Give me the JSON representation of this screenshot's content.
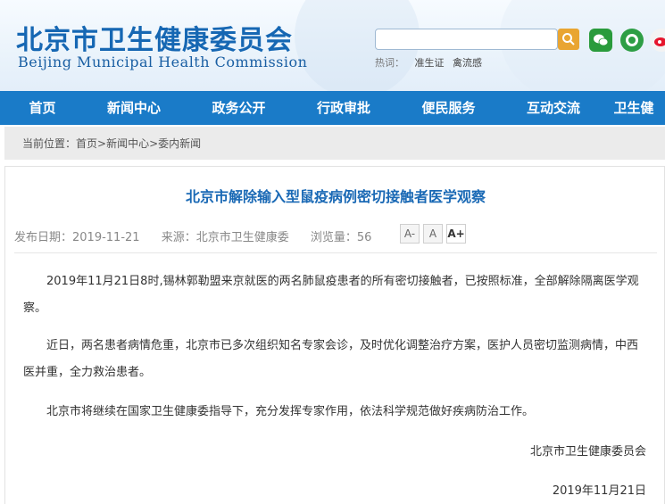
{
  "header": {
    "title_cn": "北京市卫生健康委员会",
    "title_en": "Beijing Municipal Health Commission",
    "search_placeholder": "",
    "hot_label": "热词：",
    "hot_words": [
      "准生证",
      "禽流感"
    ]
  },
  "social": {
    "wechat_icon": "wechat-icon",
    "app_icon": "app-icon",
    "weibo_icon": "weibo-icon"
  },
  "nav": {
    "items": [
      "首页",
      "新闻中心",
      "政务公开",
      "行政审批",
      "便民服务",
      "互动交流",
      "卫生健"
    ]
  },
  "breadcrumb": {
    "label": "当前位置：",
    "path": "首页>新闻中心>委内新闻"
  },
  "article": {
    "title": "北京市解除输入型鼠疫病例密切接触者医学观察",
    "publish_date": "发布日期：2019-11-21",
    "source": "来源：北京市卫生健康委",
    "views": "浏览量：56",
    "font_buttons": [
      "A-",
      "A",
      "A+"
    ],
    "paragraphs": [
      "2019年11月21日8时,锡林郭勒盟来京就医的两名肺鼠疫患者的所有密切接触者，已按照标准，全部解除隔离医学观察。",
      "近日，两名患者病情危重，北京市已多次组织知名专家会诊，及时优化调整治疗方案，医护人员密切监测病情，中西医并重，全力救治患者。",
      "北京市将继续在国家卫生健康委指导下，充分发挥专家作用，依法科学规范做好疾病防治工作。"
    ],
    "signature": "北京市卫生健康委员会",
    "date": "2019年11月21日"
  }
}
